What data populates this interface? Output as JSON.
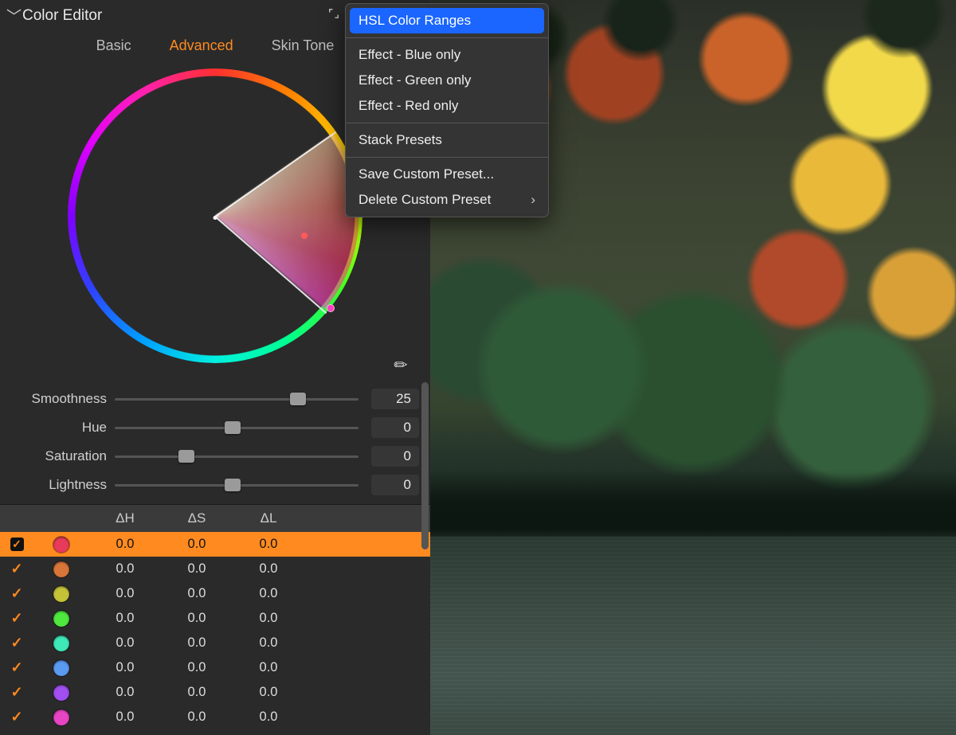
{
  "header": {
    "title": "Color Editor"
  },
  "tabs": {
    "basic": "Basic",
    "advanced": "Advanced",
    "skintone": "Skin Tone",
    "active": "advanced"
  },
  "sliders": {
    "smoothness": {
      "label": "Smoothness",
      "value": "25",
      "pos": 72
    },
    "hue": {
      "label": "Hue",
      "value": "0",
      "pos": 45
    },
    "saturation": {
      "label": "Saturation",
      "value": "0",
      "pos": 26
    },
    "lightness": {
      "label": "Lightness",
      "value": "0",
      "pos": 45
    }
  },
  "table": {
    "headers": {
      "dh": "ΔH",
      "ds": "ΔS",
      "dl": "ΔL"
    },
    "rows": [
      {
        "checked": true,
        "selected": true,
        "color": "#e83a5a",
        "dh": "0.0",
        "ds": "0.0",
        "dl": "0.0"
      },
      {
        "checked": true,
        "selected": false,
        "color": "#d8763a",
        "dh": "0.0",
        "ds": "0.0",
        "dl": "0.0"
      },
      {
        "checked": true,
        "selected": false,
        "color": "#c5c23a",
        "dh": "0.0",
        "ds": "0.0",
        "dl": "0.0"
      },
      {
        "checked": true,
        "selected": false,
        "color": "#4ee83e",
        "dh": "0.0",
        "ds": "0.0",
        "dl": "0.0"
      },
      {
        "checked": true,
        "selected": false,
        "color": "#3ee8b8",
        "dh": "0.0",
        "ds": "0.0",
        "dl": "0.0"
      },
      {
        "checked": true,
        "selected": false,
        "color": "#5a9af0",
        "dh": "0.0",
        "ds": "0.0",
        "dl": "0.0"
      },
      {
        "checked": true,
        "selected": false,
        "color": "#a050f0",
        "dh": "0.0",
        "ds": "0.0",
        "dl": "0.0"
      },
      {
        "checked": true,
        "selected": false,
        "color": "#e845c5",
        "dh": "0.0",
        "ds": "0.0",
        "dl": "0.0"
      }
    ]
  },
  "menu": {
    "hsl": "HSL Color Ranges",
    "blue": "Effect - Blue only",
    "green": "Effect - Green only",
    "red": "Effect - Red only",
    "stack": "Stack Presets",
    "save": "Save Custom Preset...",
    "delete": "Delete Custom Preset"
  }
}
